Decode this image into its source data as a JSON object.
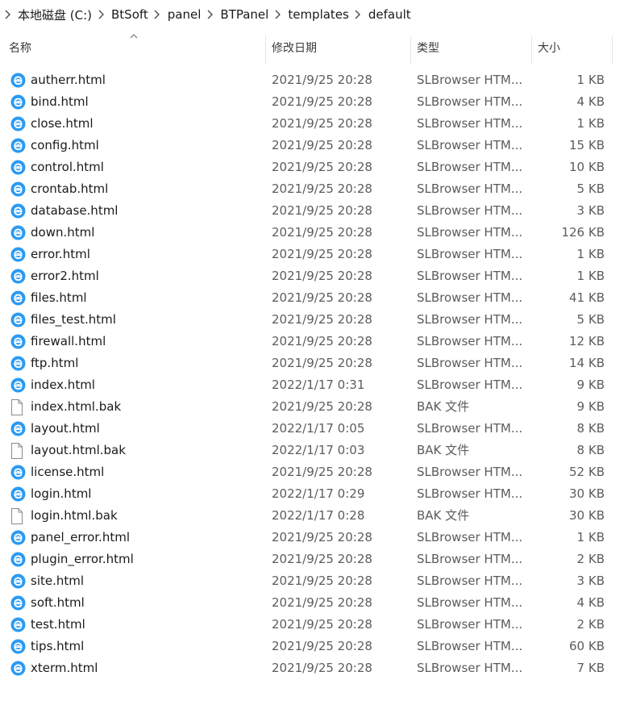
{
  "breadcrumb": [
    {
      "label": "本地磁盘 (C:)"
    },
    {
      "label": "BtSoft"
    },
    {
      "label": "panel"
    },
    {
      "label": "BTPanel"
    },
    {
      "label": "templates"
    },
    {
      "label": "default"
    }
  ],
  "columns": {
    "name": "名称",
    "date": "修改日期",
    "type": "类型",
    "size": "大小"
  },
  "colors": {
    "html_icon": "#2b9af3",
    "text_primary": "#1a1a1a",
    "text_secondary": "#5c5c5c"
  },
  "files": [
    {
      "icon": "slbrowser-html-icon",
      "name": "autherr.html",
      "date": "2021/9/25 20:28",
      "type": "SLBrowser HTM...",
      "size": "1 KB"
    },
    {
      "icon": "slbrowser-html-icon",
      "name": "bind.html",
      "date": "2021/9/25 20:28",
      "type": "SLBrowser HTM...",
      "size": "4 KB"
    },
    {
      "icon": "slbrowser-html-icon",
      "name": "close.html",
      "date": "2021/9/25 20:28",
      "type": "SLBrowser HTM...",
      "size": "1 KB"
    },
    {
      "icon": "slbrowser-html-icon",
      "name": "config.html",
      "date": "2021/9/25 20:28",
      "type": "SLBrowser HTM...",
      "size": "15 KB"
    },
    {
      "icon": "slbrowser-html-icon",
      "name": "control.html",
      "date": "2021/9/25 20:28",
      "type": "SLBrowser HTM...",
      "size": "10 KB"
    },
    {
      "icon": "slbrowser-html-icon",
      "name": "crontab.html",
      "date": "2021/9/25 20:28",
      "type": "SLBrowser HTM...",
      "size": "5 KB"
    },
    {
      "icon": "slbrowser-html-icon",
      "name": "database.html",
      "date": "2021/9/25 20:28",
      "type": "SLBrowser HTM...",
      "size": "3 KB"
    },
    {
      "icon": "slbrowser-html-icon",
      "name": "down.html",
      "date": "2021/9/25 20:28",
      "type": "SLBrowser HTM...",
      "size": "126 KB"
    },
    {
      "icon": "slbrowser-html-icon",
      "name": "error.html",
      "date": "2021/9/25 20:28",
      "type": "SLBrowser HTM...",
      "size": "1 KB"
    },
    {
      "icon": "slbrowser-html-icon",
      "name": "error2.html",
      "date": "2021/9/25 20:28",
      "type": "SLBrowser HTM...",
      "size": "1 KB"
    },
    {
      "icon": "slbrowser-html-icon",
      "name": "files.html",
      "date": "2021/9/25 20:28",
      "type": "SLBrowser HTM...",
      "size": "41 KB"
    },
    {
      "icon": "slbrowser-html-icon",
      "name": "files_test.html",
      "date": "2021/9/25 20:28",
      "type": "SLBrowser HTM...",
      "size": "5 KB"
    },
    {
      "icon": "slbrowser-html-icon",
      "name": "firewall.html",
      "date": "2021/9/25 20:28",
      "type": "SLBrowser HTM...",
      "size": "12 KB"
    },
    {
      "icon": "slbrowser-html-icon",
      "name": "ftp.html",
      "date": "2021/9/25 20:28",
      "type": "SLBrowser HTM...",
      "size": "14 KB"
    },
    {
      "icon": "slbrowser-html-icon",
      "name": "index.html",
      "date": "2022/1/17 0:31",
      "type": "SLBrowser HTM...",
      "size": "9 KB"
    },
    {
      "icon": "file-icon",
      "name": "index.html.bak",
      "date": "2021/9/25 20:28",
      "type": "BAK 文件",
      "size": "9 KB"
    },
    {
      "icon": "slbrowser-html-icon",
      "name": "layout.html",
      "date": "2022/1/17 0:05",
      "type": "SLBrowser HTM...",
      "size": "8 KB"
    },
    {
      "icon": "file-icon",
      "name": "layout.html.bak",
      "date": "2022/1/17 0:03",
      "type": "BAK 文件",
      "size": "8 KB"
    },
    {
      "icon": "slbrowser-html-icon",
      "name": "license.html",
      "date": "2021/9/25 20:28",
      "type": "SLBrowser HTM...",
      "size": "52 KB"
    },
    {
      "icon": "slbrowser-html-icon",
      "name": "login.html",
      "date": "2022/1/17 0:29",
      "type": "SLBrowser HTM...",
      "size": "30 KB"
    },
    {
      "icon": "file-icon",
      "name": "login.html.bak",
      "date": "2022/1/17 0:28",
      "type": "BAK 文件",
      "size": "30 KB"
    },
    {
      "icon": "slbrowser-html-icon",
      "name": "panel_error.html",
      "date": "2021/9/25 20:28",
      "type": "SLBrowser HTM...",
      "size": "1 KB"
    },
    {
      "icon": "slbrowser-html-icon",
      "name": "plugin_error.html",
      "date": "2021/9/25 20:28",
      "type": "SLBrowser HTM...",
      "size": "2 KB"
    },
    {
      "icon": "slbrowser-html-icon",
      "name": "site.html",
      "date": "2021/9/25 20:28",
      "type": "SLBrowser HTM...",
      "size": "3 KB"
    },
    {
      "icon": "slbrowser-html-icon",
      "name": "soft.html",
      "date": "2021/9/25 20:28",
      "type": "SLBrowser HTM...",
      "size": "4 KB"
    },
    {
      "icon": "slbrowser-html-icon",
      "name": "test.html",
      "date": "2021/9/25 20:28",
      "type": "SLBrowser HTM...",
      "size": "2 KB"
    },
    {
      "icon": "slbrowser-html-icon",
      "name": "tips.html",
      "date": "2021/9/25 20:28",
      "type": "SLBrowser HTM...",
      "size": "60 KB"
    },
    {
      "icon": "slbrowser-html-icon",
      "name": "xterm.html",
      "date": "2021/9/25 20:28",
      "type": "SLBrowser HTM...",
      "size": "7 KB"
    }
  ]
}
